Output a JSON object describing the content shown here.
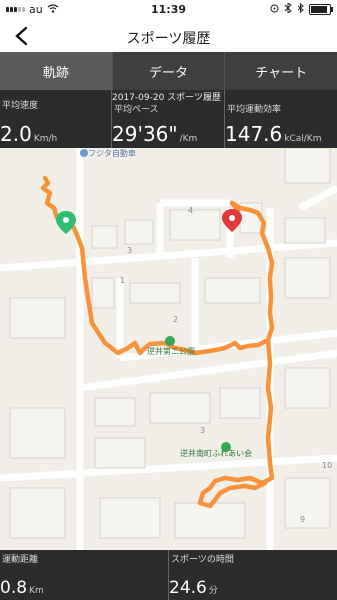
{
  "status": {
    "carrier": "au",
    "time": "11:39"
  },
  "header": {
    "title": "スポーツ履歴"
  },
  "tabs": [
    {
      "label": "軌跡",
      "active": true
    },
    {
      "label": "データ",
      "active": false
    },
    {
      "label": "チャート",
      "active": false
    }
  ],
  "stats": {
    "date_title": "2017-09-20 スポーツ履歴",
    "speed": {
      "label": "平均速度",
      "value": "2.0",
      "unit": "Km/h"
    },
    "pace": {
      "label": "平均ペース",
      "value": "29'36\"",
      "unit": "/Km"
    },
    "efficiency": {
      "label": "平均運動効率",
      "value": "147.6",
      "unit": "kCal/Km"
    }
  },
  "map": {
    "labels": {
      "place_fujita": "フジタ自動車",
      "park1": "逆井第二公園",
      "park2": "逆井南町ふれあい会",
      "block_3a": "3",
      "block_4": "4",
      "block_1": "1",
      "block_2": "2",
      "block_3b": "3",
      "block_10": "10",
      "block_9": "9"
    },
    "colors": {
      "route": "#f7923a",
      "start_pin": "#2fbf71",
      "end_pin": "#e23a3a"
    }
  },
  "bottom": {
    "distance": {
      "label": "運動距離",
      "value": "0.8",
      "unit": "Km"
    },
    "duration": {
      "label": "スポーツの時間",
      "value": "24.6",
      "unit": "分"
    }
  }
}
